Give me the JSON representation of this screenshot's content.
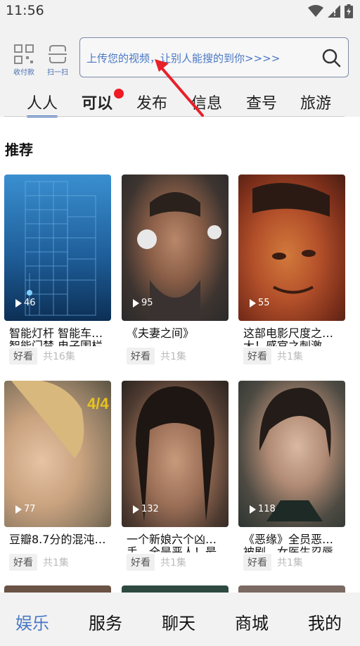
{
  "status_bar": {
    "time": "11:56"
  },
  "header": {
    "quick_actions": [
      {
        "icon": "qr-grid-icon",
        "label": "收付款"
      },
      {
        "icon": "scan-icon",
        "label": "扫一扫"
      }
    ],
    "search": {
      "placeholder": "上传您的视频，让别人能搜的到你>>>>"
    },
    "tabs": [
      {
        "label": "人人",
        "active": true
      },
      {
        "label": "可以",
        "badge": "red-dot"
      },
      {
        "label": "发布"
      },
      {
        "label": "信息"
      },
      {
        "label": "查号"
      },
      {
        "label": "旅游"
      }
    ]
  },
  "section": {
    "title": "推荐"
  },
  "cards": [
    {
      "title": "智能灯杆 智能车…",
      "subtitle": "智能门禁 电子围栏",
      "plays": "46",
      "tag": "好看",
      "episodes": "共16集",
      "theme": "#2a6fa8"
    },
    {
      "title": "《夫妻之间》",
      "subtitle": "",
      "plays": "95",
      "tag": "好看",
      "episodes": "共1集",
      "theme": "#4a3a30"
    },
    {
      "title": "这部电影尺度之…",
      "subtitle": "大！感官之刺激",
      "plays": "55",
      "tag": "好看",
      "episodes": "共1集",
      "theme": "#b8502a"
    },
    {
      "title": "豆瓣8.7分的混沌…",
      "subtitle": "",
      "plays": "77",
      "tag": "好看",
      "episodes": "共1集",
      "theme": "#9a8a6a"
    },
    {
      "title": "一个新娘六个凶…",
      "subtitle": "手，全是恶人！最",
      "plays": "132",
      "tag": "好看",
      "episodes": "共1集",
      "theme": "#7a5a48"
    },
    {
      "title": "《恶缘》全员恶…",
      "subtitle": "被剧，女医生忍辱",
      "plays": "118",
      "tag": "好看",
      "episodes": "共1集",
      "theme": "#3e4a45"
    }
  ],
  "bottom_nav": [
    {
      "label": "娱乐",
      "active": true
    },
    {
      "label": "服务"
    },
    {
      "label": "聊天"
    },
    {
      "label": "商城"
    },
    {
      "label": "我的"
    }
  ],
  "colors": {
    "accent": "#4a78c4",
    "badge": "#ee1b24",
    "arrow": "#e8202a"
  }
}
